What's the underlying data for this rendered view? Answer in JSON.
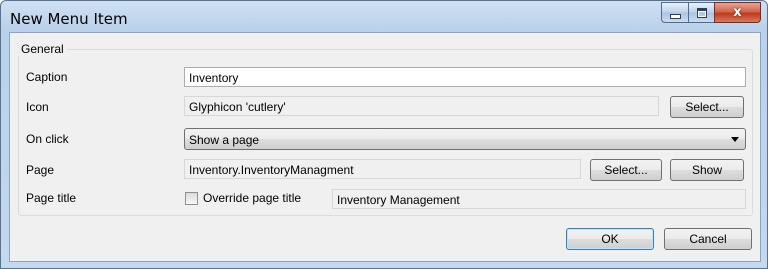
{
  "window": {
    "title": "New Menu Item",
    "close_glyph": "x"
  },
  "group": {
    "legend": "General"
  },
  "caption": {
    "label": "Caption",
    "value": "Inventory"
  },
  "icon_row": {
    "label": "Icon",
    "value": "Glyphicon 'cutlery'",
    "select_label": "Select..."
  },
  "on_click": {
    "label": "On click",
    "selected": "Show a page"
  },
  "page_row": {
    "label": "Page",
    "value": "Inventory.InventoryManagment",
    "select_label": "Select...",
    "show_label": "Show"
  },
  "page_title": {
    "label": "Page title",
    "override_label": "Override page title",
    "override_checked": false,
    "value": "Inventory Management"
  },
  "footer": {
    "ok_label": "OK",
    "cancel_label": "Cancel"
  },
  "colors": {
    "title_bar": "#b9d1ea",
    "close_button": "#c0391d",
    "dialog_bg": "#f0f0f0",
    "default_button_border": "#3c7fb1"
  }
}
